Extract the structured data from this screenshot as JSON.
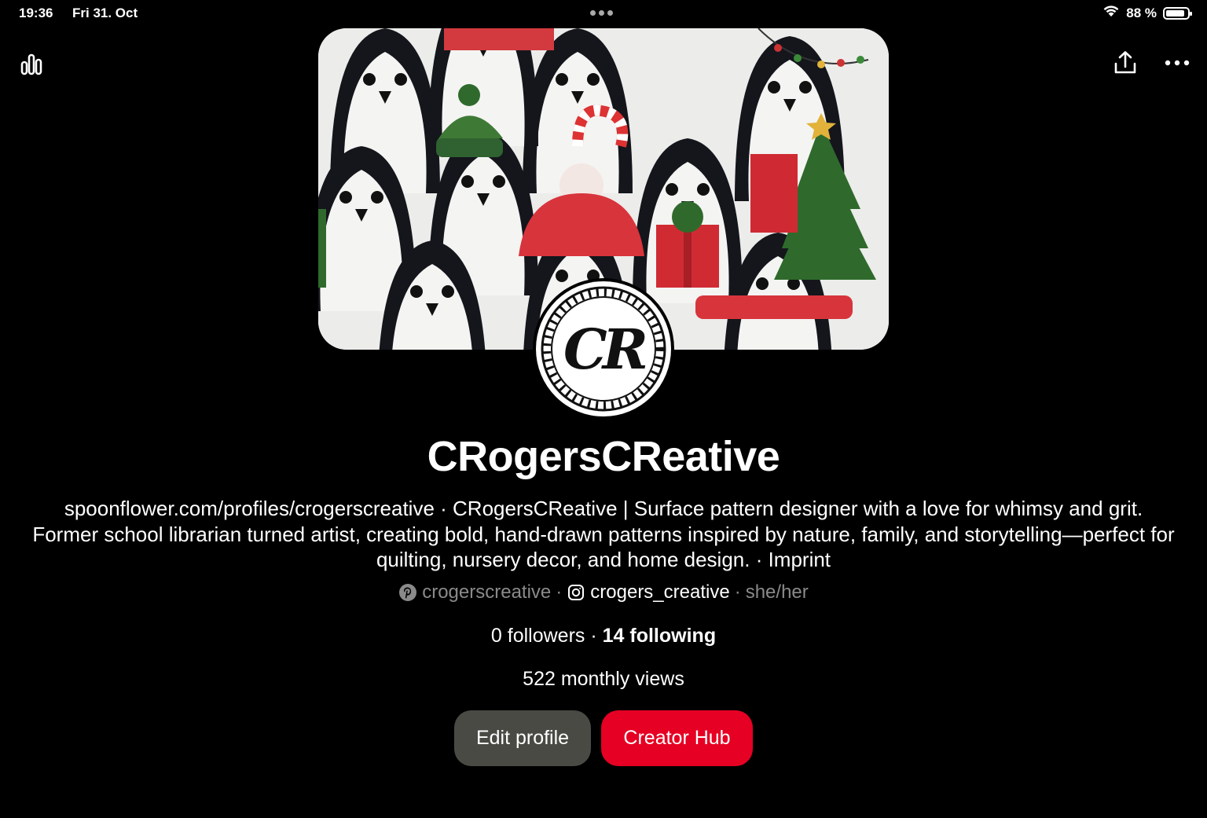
{
  "status_bar": {
    "time": "19:36",
    "date": "Fri 31. Oct",
    "battery": "88 %",
    "battery_level": 0.88
  },
  "toolbar": {
    "analytics_icon": "bar-chart-icon",
    "share_icon": "share-upload-icon",
    "more_icon": "more-horizontal-icon"
  },
  "cover": {
    "description_icon": "penguin-pattern-cover"
  },
  "avatar": {
    "initials": "CR"
  },
  "profile": {
    "name": "CRogersCReative",
    "bio": "spoonflower.com/profiles/crogerscreative · CRogersCReative | Surface pattern designer with a love for whimsy and grit. Former school librarian turned artist, creating bold, hand-drawn patterns inspired by nature, family, and storytelling—perfect for quilting, nursery decor, and home design. · Imprint",
    "pinterest_handle": "crogerscreative",
    "instagram_handle": "crogers_creative",
    "pronouns": "she/her",
    "sep": "·",
    "followers": "0 followers",
    "following": "14 following",
    "monthly_views": "522 monthly views"
  },
  "buttons": {
    "edit_profile": "Edit profile",
    "creator_hub": "Creator Hub"
  },
  "colors": {
    "accent": "#e60023",
    "secondary_button": "#4a4a45",
    "background": "#000000",
    "muted_text": "#8a8a8a"
  }
}
